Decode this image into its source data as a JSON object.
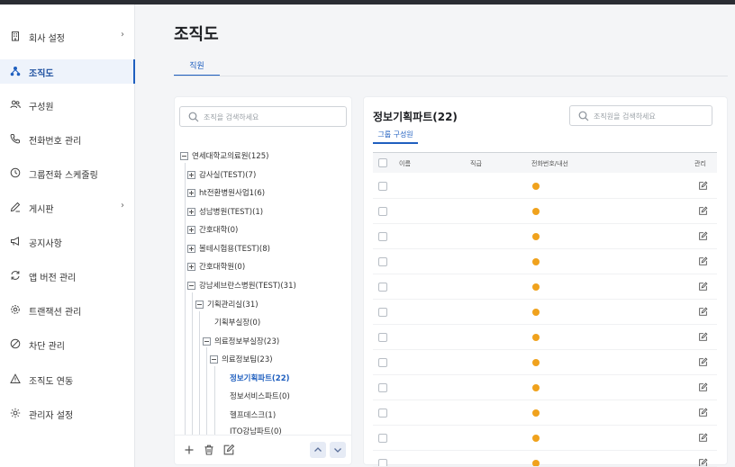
{
  "sidebar": {
    "items": [
      {
        "label": "회사 설정",
        "icon": "building-icon",
        "chevron": "›"
      },
      {
        "label": "조직도",
        "icon": "org-chart-icon",
        "chevron": ""
      },
      {
        "label": "구성원",
        "icon": "people-icon",
        "chevron": ""
      },
      {
        "label": "전화번호 관리",
        "icon": "phone-icon",
        "chevron": ""
      },
      {
        "label": "그룹전화 스케줄링",
        "icon": "clock-icon",
        "chevron": ""
      },
      {
        "label": "게시판",
        "icon": "pen-icon",
        "chevron": "›"
      },
      {
        "label": "공지사항",
        "icon": "megaphone-icon",
        "chevron": ""
      },
      {
        "label": "앱 버전 관리",
        "icon": "refresh-icon",
        "chevron": ""
      },
      {
        "label": "트랜잭션 관리",
        "icon": "gear-icon",
        "chevron": ""
      },
      {
        "label": "차단 관리",
        "icon": "block-icon",
        "chevron": ""
      },
      {
        "label": "조직도 연동",
        "icon": "warning-icon",
        "chevron": ""
      },
      {
        "label": "관리자 설정",
        "icon": "settings-icon",
        "chevron": ""
      }
    ],
    "active_index": 1
  },
  "page": {
    "title": "조직도",
    "tab": "직원"
  },
  "tree": {
    "search_placeholder": "조직을 검색하세요",
    "nodes": [
      {
        "label": "연세대학교의료원(125)",
        "toggle": "minus"
      },
      {
        "label": "감사실(TEST)(7)",
        "toggle": "plus"
      },
      {
        "label": "ht전환병원사업1(6)",
        "toggle": "plus"
      },
      {
        "label": "성남병원(TEST)(1)",
        "toggle": "plus"
      },
      {
        "label": "간호대학(0)",
        "toggle": "plus"
      },
      {
        "label": "볼테시험용(TEST)(8)",
        "toggle": "plus"
      },
      {
        "label": "간호대학원(0)",
        "toggle": "plus"
      },
      {
        "label": "강남세브란스병원(TEST)(31)",
        "toggle": "minus"
      },
      {
        "label": "기획관리실(31)",
        "toggle": "minus"
      },
      {
        "label": "기획부실장(0)",
        "toggle": "none"
      },
      {
        "label": "의료정보부실장(23)",
        "toggle": "minus"
      },
      {
        "label": "의료정보팀(23)",
        "toggle": "minus"
      },
      {
        "label": "정보기획파트(22)",
        "toggle": "none",
        "selected": true
      },
      {
        "label": "정보서비스파트(0)",
        "toggle": "none"
      },
      {
        "label": "헬프데스크(1)",
        "toggle": "none"
      },
      {
        "label": "ITO강남파트(0)",
        "toggle": "none"
      }
    ]
  },
  "detail": {
    "title": "정보기획파트(22)",
    "search_placeholder": "조직원을 검색하세요",
    "tab": "그룹 구성원",
    "columns": {
      "name": "이름",
      "position": "직급",
      "phone": "전화번호/내선",
      "manage": "관리"
    },
    "row_count": 12,
    "status_color": "#f0a21d"
  },
  "colors": {
    "accent": "#1f5fbf",
    "topbar": "#2a2d33"
  }
}
